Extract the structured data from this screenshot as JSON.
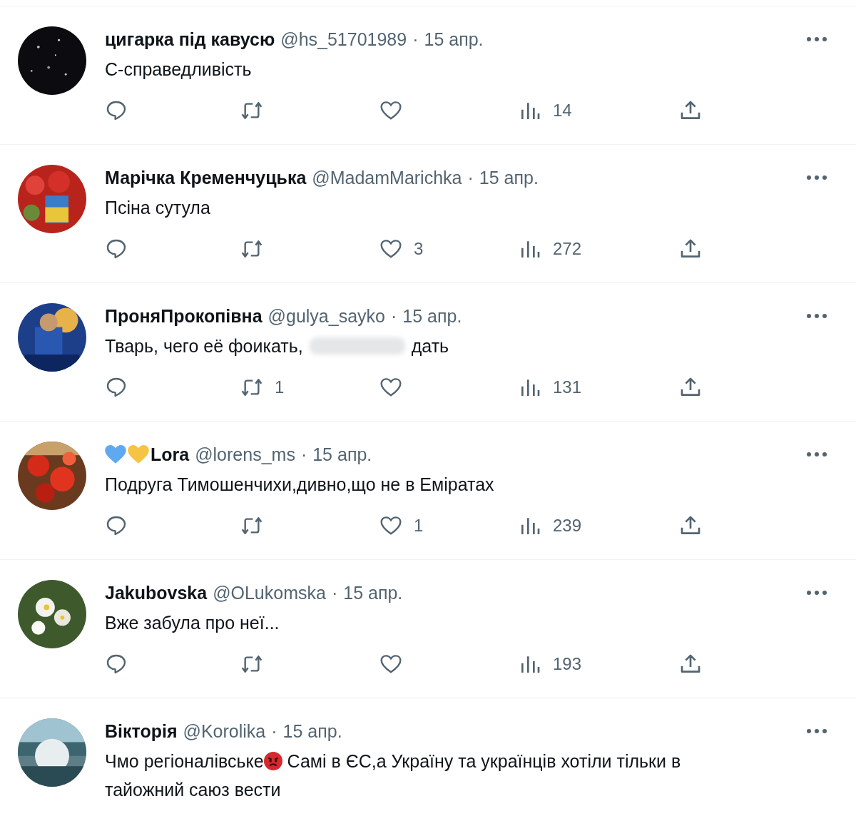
{
  "tweets": [
    {
      "name": "цигарка під кавусю",
      "handle": "@hs_51701989",
      "dot": "·",
      "date": "15 апр.",
      "body": [
        {
          "kind": "text",
          "text": "С-справедливість"
        }
      ],
      "stats": [
        {
          "kind": "reply"
        },
        {
          "kind": "retweet"
        },
        {
          "kind": "like"
        },
        {
          "kind": "views",
          "count": "14"
        },
        {
          "kind": "share"
        }
      ]
    },
    {
      "name": "Марічка Кременчуцька",
      "handle": "@MadamMarichka",
      "dot": "·",
      "date": "15 апр.",
      "body": [
        {
          "kind": "text",
          "text": "Псіна сутула"
        }
      ],
      "stats": [
        {
          "kind": "reply"
        },
        {
          "kind": "retweet"
        },
        {
          "kind": "like",
          "count": "3"
        },
        {
          "kind": "views",
          "count": "272"
        },
        {
          "kind": "share"
        }
      ]
    },
    {
      "name": "ПроняПрокопівна",
      "handle": "@gulya_sayko",
      "dot": "·",
      "date": "15 апр.",
      "body": [
        {
          "kind": "text",
          "text": "Тварь, чего её фоикать,"
        },
        {
          "kind": "redacted"
        },
        {
          "kind": "text",
          "text": "дать"
        }
      ],
      "stats": [
        {
          "kind": "reply"
        },
        {
          "kind": "retweet",
          "count": "1"
        },
        {
          "kind": "like"
        },
        {
          "kind": "views",
          "count": "131"
        },
        {
          "kind": "share"
        }
      ]
    },
    {
      "name_hearts": [
        {
          "color": "#5ea9ef"
        },
        {
          "color": "#f6c344"
        }
      ],
      "name": "Lora",
      "handle": "@lorens_ms",
      "dot": "·",
      "date": "15 апр.",
      "body": [
        {
          "kind": "text",
          "text": "Подруга Тимошенчихи,дивно,що не в Еміратах"
        }
      ],
      "stats": [
        {
          "kind": "reply"
        },
        {
          "kind": "retweet"
        },
        {
          "kind": "like",
          "count": "1"
        },
        {
          "kind": "views",
          "count": "239"
        },
        {
          "kind": "share"
        }
      ]
    },
    {
      "name": "Jakubovska",
      "handle": "@OLukomska",
      "dot": "·",
      "date": "15 апр.",
      "body": [
        {
          "kind": "text",
          "text": "Вже забула про неї..."
        }
      ],
      "stats": [
        {
          "kind": "reply"
        },
        {
          "kind": "retweet"
        },
        {
          "kind": "like"
        },
        {
          "kind": "views",
          "count": "193"
        },
        {
          "kind": "share"
        }
      ]
    },
    {
      "name": "Вікторія",
      "handle": "@Korolika",
      "dot": "·",
      "date": "15 апр.",
      "body": [
        {
          "kind": "text",
          "text": "Чмо регіоналівське"
        },
        {
          "kind": "angry-face"
        },
        {
          "kind": "text",
          "text": "Самі в ЄС,а Україну та українців хотіли тільки в"
        },
        {
          "kind": "text",
          "text": "тайожний саюз вести"
        }
      ]
    }
  ]
}
